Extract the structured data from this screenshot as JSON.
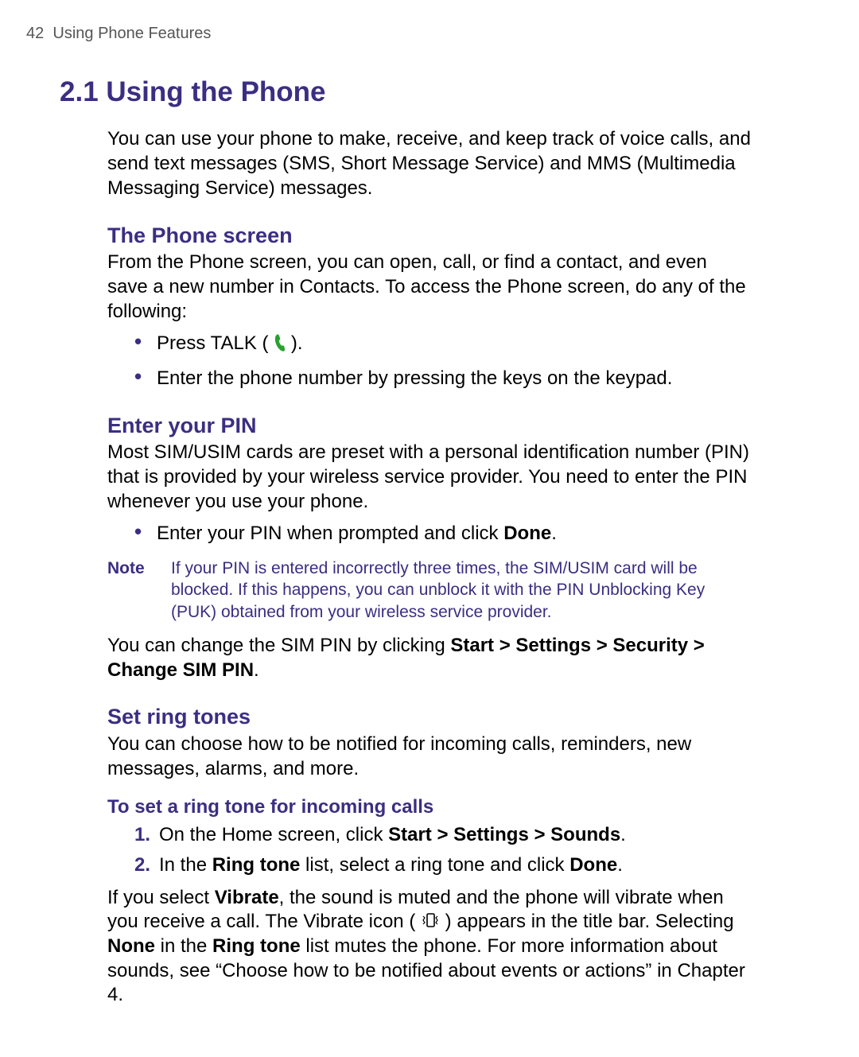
{
  "header": {
    "page_number": "42",
    "chapter": "Using Phone Features"
  },
  "section": {
    "number": "2.1",
    "title": "Using the Phone",
    "intro": "You can use your phone to make, receive, and keep track of voice calls, and send text messages (SMS, Short Message Service) and MMS (Multimedia Messaging Service) messages."
  },
  "phone_screen": {
    "heading": "The Phone screen",
    "text": "From the Phone screen, you can open, call, or find a contact, and even save a new number in Contacts. To access the Phone screen, do any of the following:",
    "bullets": {
      "b1_pre": "Press TALK ( ",
      "b1_post": " ).",
      "b2": "Enter the phone number by pressing the keys on the keypad."
    }
  },
  "pin": {
    "heading": "Enter your PIN",
    "text": "Most SIM/USIM cards are preset with a personal identification number (PIN) that is provided by your wireless service provider. You need to enter the PIN whenever you use your phone.",
    "bullet_pre": "Enter your PIN when prompted and click ",
    "bullet_bold": "Done",
    "bullet_post": ".",
    "note_label": "Note",
    "note_body": "If your PIN is entered incorrectly three times, the SIM/USIM card will be blocked. If this happens, you can unblock it with the PIN Unblocking Key (PUK) obtained from your wireless service provider.",
    "change_pre": "You can change the SIM PIN by clicking ",
    "change_bold": "Start > Settings > Security > Change SIM PIN",
    "change_post": "."
  },
  "ring": {
    "heading": "Set ring tones",
    "text": "You can choose how to be notified for incoming calls, reminders, new messages, alarms, and more.",
    "sub": "To set a ring tone for incoming calls",
    "step1_pre": "On the Home screen, click ",
    "step1_bold": "Start > Settings > Sounds",
    "step1_post": ".",
    "step2_a": "In the ",
    "step2_b": "Ring tone",
    "step2_c": " list, select a ring tone and click ",
    "step2_d": "Done",
    "step2_e": ".",
    "closing_a": "If you select ",
    "closing_b": "Vibrate",
    "closing_c": ", the sound is muted and the phone will vibrate when you receive a call. The Vibrate icon ( ",
    "closing_d": " ) appears in the title bar. Selecting ",
    "closing_e": "None",
    "closing_f": " in the ",
    "closing_g": "Ring tone",
    "closing_h": " list mutes the phone. For more information about sounds, see “Choose how to be notified about events or actions” in Chapter 4."
  },
  "icons": {
    "talk": "talk-icon",
    "vibrate": "vibrate-icon"
  }
}
